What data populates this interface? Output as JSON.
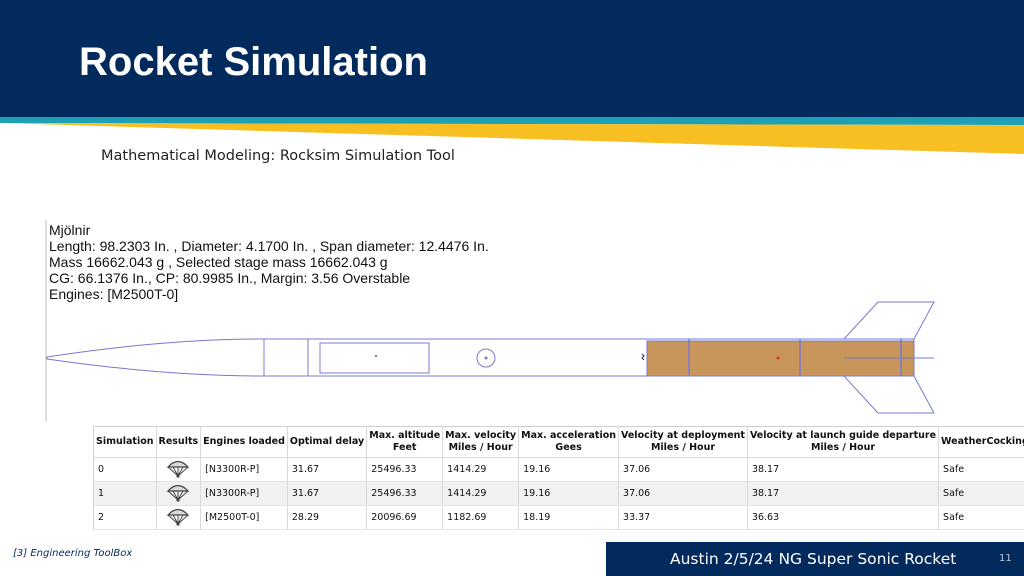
{
  "slide": {
    "title": "Rocket Simulation",
    "subtitle": "Mathematical Modeling: Rocksim Simulation Tool",
    "colors": {
      "navy": "#022a5c",
      "teal": "#1fa1b5",
      "gold": "#f7bf22",
      "motor": "#c8965a",
      "outline": "#7878d2"
    }
  },
  "rocket_info": {
    "name": "Mjölnir",
    "line_length": "Length: 98.2303  In. , Diameter: 4.1700  In. , Span diameter: 12.4476  In.",
    "line_mass": "Mass 16662.043 g , Selected stage mass 16662.043 g",
    "line_cg": "CG: 66.1376 In., CP: 80.9985 In., Margin: 3.56 Overstable",
    "line_engines": "Engines: [M2500T-0]"
  },
  "table": {
    "headers": [
      [
        "Simulation"
      ],
      [
        "Results"
      ],
      [
        "Engines loaded"
      ],
      [
        "Optimal delay"
      ],
      [
        "Max. altitude",
        "Feet"
      ],
      [
        "Max. velocity",
        "Miles / Hour"
      ],
      [
        "Max. acceleration",
        "Gees"
      ],
      [
        "Velocity at deployment",
        "Miles / Hour"
      ],
      [
        "Velocity at launch guide departure",
        "Miles / Hour"
      ],
      [
        "WeatherCocking"
      ]
    ],
    "rows": [
      {
        "simulation": "0",
        "result_icon": "parachute-icon",
        "engines": "[N3300R-P]",
        "delay": "31.67",
        "altitude": "25496.33",
        "velocity": "1414.29",
        "acceleration": "19.16",
        "deploy_velocity": "37.06",
        "guide_velocity": "38.17",
        "weathercocking": "Safe"
      },
      {
        "simulation": "1",
        "result_icon": "parachute-icon",
        "engines": "[N3300R-P]",
        "delay": "31.67",
        "altitude": "25496.33",
        "velocity": "1414.29",
        "acceleration": "19.16",
        "deploy_velocity": "37.06",
        "guide_velocity": "38.17",
        "weathercocking": "Safe"
      },
      {
        "simulation": "2",
        "result_icon": "parachute-icon",
        "engines": "[M2500T-0]",
        "delay": "28.29",
        "altitude": "20096.69",
        "velocity": "1182.69",
        "acceleration": "18.19",
        "deploy_velocity": "33.37",
        "guide_velocity": "36.63",
        "weathercocking": "Safe"
      }
    ]
  },
  "footer": {
    "citation": "[3] Engineering ToolBox",
    "event": "Austin 2/5/24 NG Super Sonic Rocket",
    "page": "11"
  }
}
